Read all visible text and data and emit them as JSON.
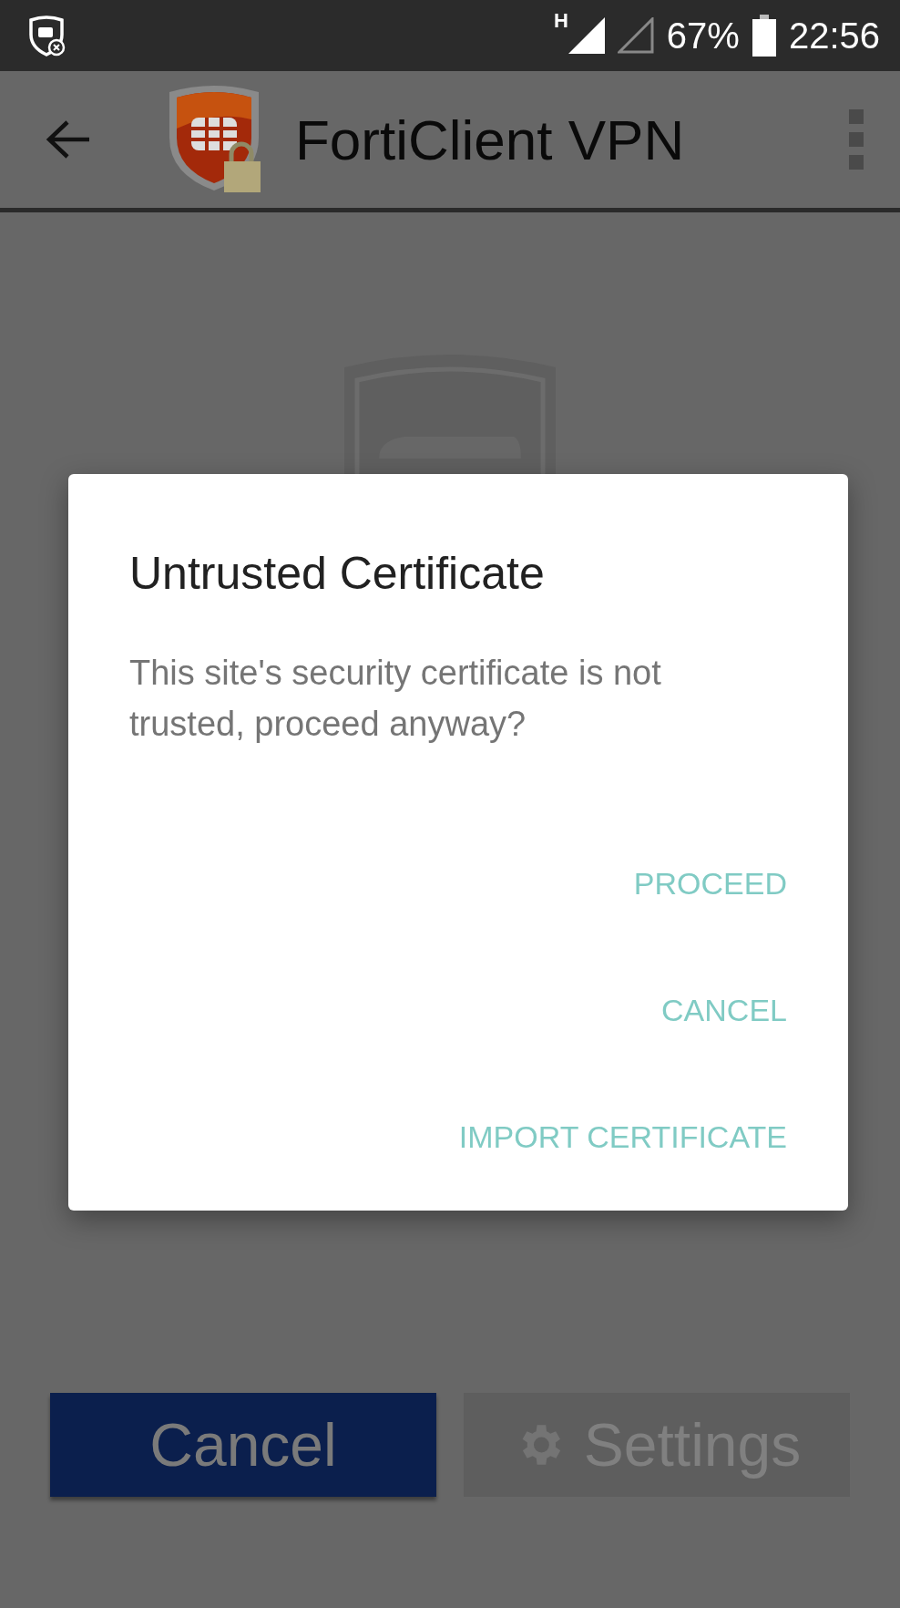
{
  "status_bar": {
    "network": "H",
    "battery": "67%",
    "time": "22:56"
  },
  "app_bar": {
    "title": "FortiClient VPN"
  },
  "dialog": {
    "title": "Untrusted Certificate",
    "message": "This site's security certificate is not trusted, proceed anyway?",
    "actions": [
      "PROCEED",
      "CANCEL",
      "IMPORT CERTIFICATE"
    ]
  },
  "buttons": [
    {
      "label": "Cancel",
      "kind": "primary"
    },
    {
      "label": "Settings",
      "kind": "settings"
    }
  ]
}
